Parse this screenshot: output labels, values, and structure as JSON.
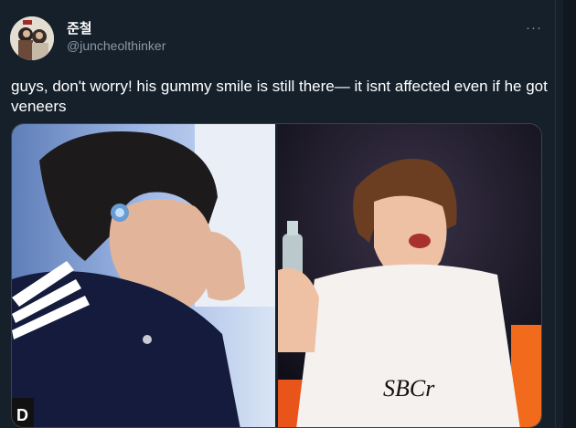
{
  "tweet": {
    "display_name": "준철",
    "handle": "@juncheolthinker",
    "more_icon": "···",
    "text": "guys, don't worry! his gummy smile is still there— it isnt affected even if he got veneers"
  },
  "media": {
    "left_photo_label": "",
    "right_photo_signature": "SBCr"
  },
  "colors": {
    "background": "#15202b",
    "secondary_text": "#8b98a5",
    "border": "#38444d"
  }
}
